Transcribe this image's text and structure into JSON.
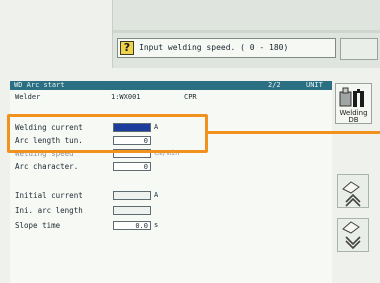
{
  "prompt": {
    "text": "Input welding speed. ( 0 - 180)"
  },
  "panel": {
    "title": "WD Arc start",
    "page": "2/2",
    "unit_badge": "UNIT",
    "header_label": "Welder",
    "header_value": "1:WX001",
    "header_extra": "CPR"
  },
  "fields": [
    {
      "label": "Welding current",
      "value": "",
      "unit": "A"
    },
    {
      "label": "Arc length tun.",
      "value": "0",
      "unit": ""
    },
    {
      "label": "Welding speed",
      "value": "",
      "unit": "cm/min"
    },
    {
      "label": "Arc character.",
      "value": "0",
      "unit": ""
    },
    {
      "label": "Initial current",
      "value": "",
      "unit": "A"
    },
    {
      "label": "Ini. arc length",
      "value": "",
      "unit": ""
    },
    {
      "label": "Slope time",
      "value": "0.0",
      "unit": "s"
    }
  ],
  "right_panel": {
    "welding_db_label_1": "Welding",
    "welding_db_label_2": "DB"
  },
  "colors": {
    "title_bar": "#2a6f82",
    "highlight": "#f2921e",
    "active_field": "#1c3d9c"
  }
}
